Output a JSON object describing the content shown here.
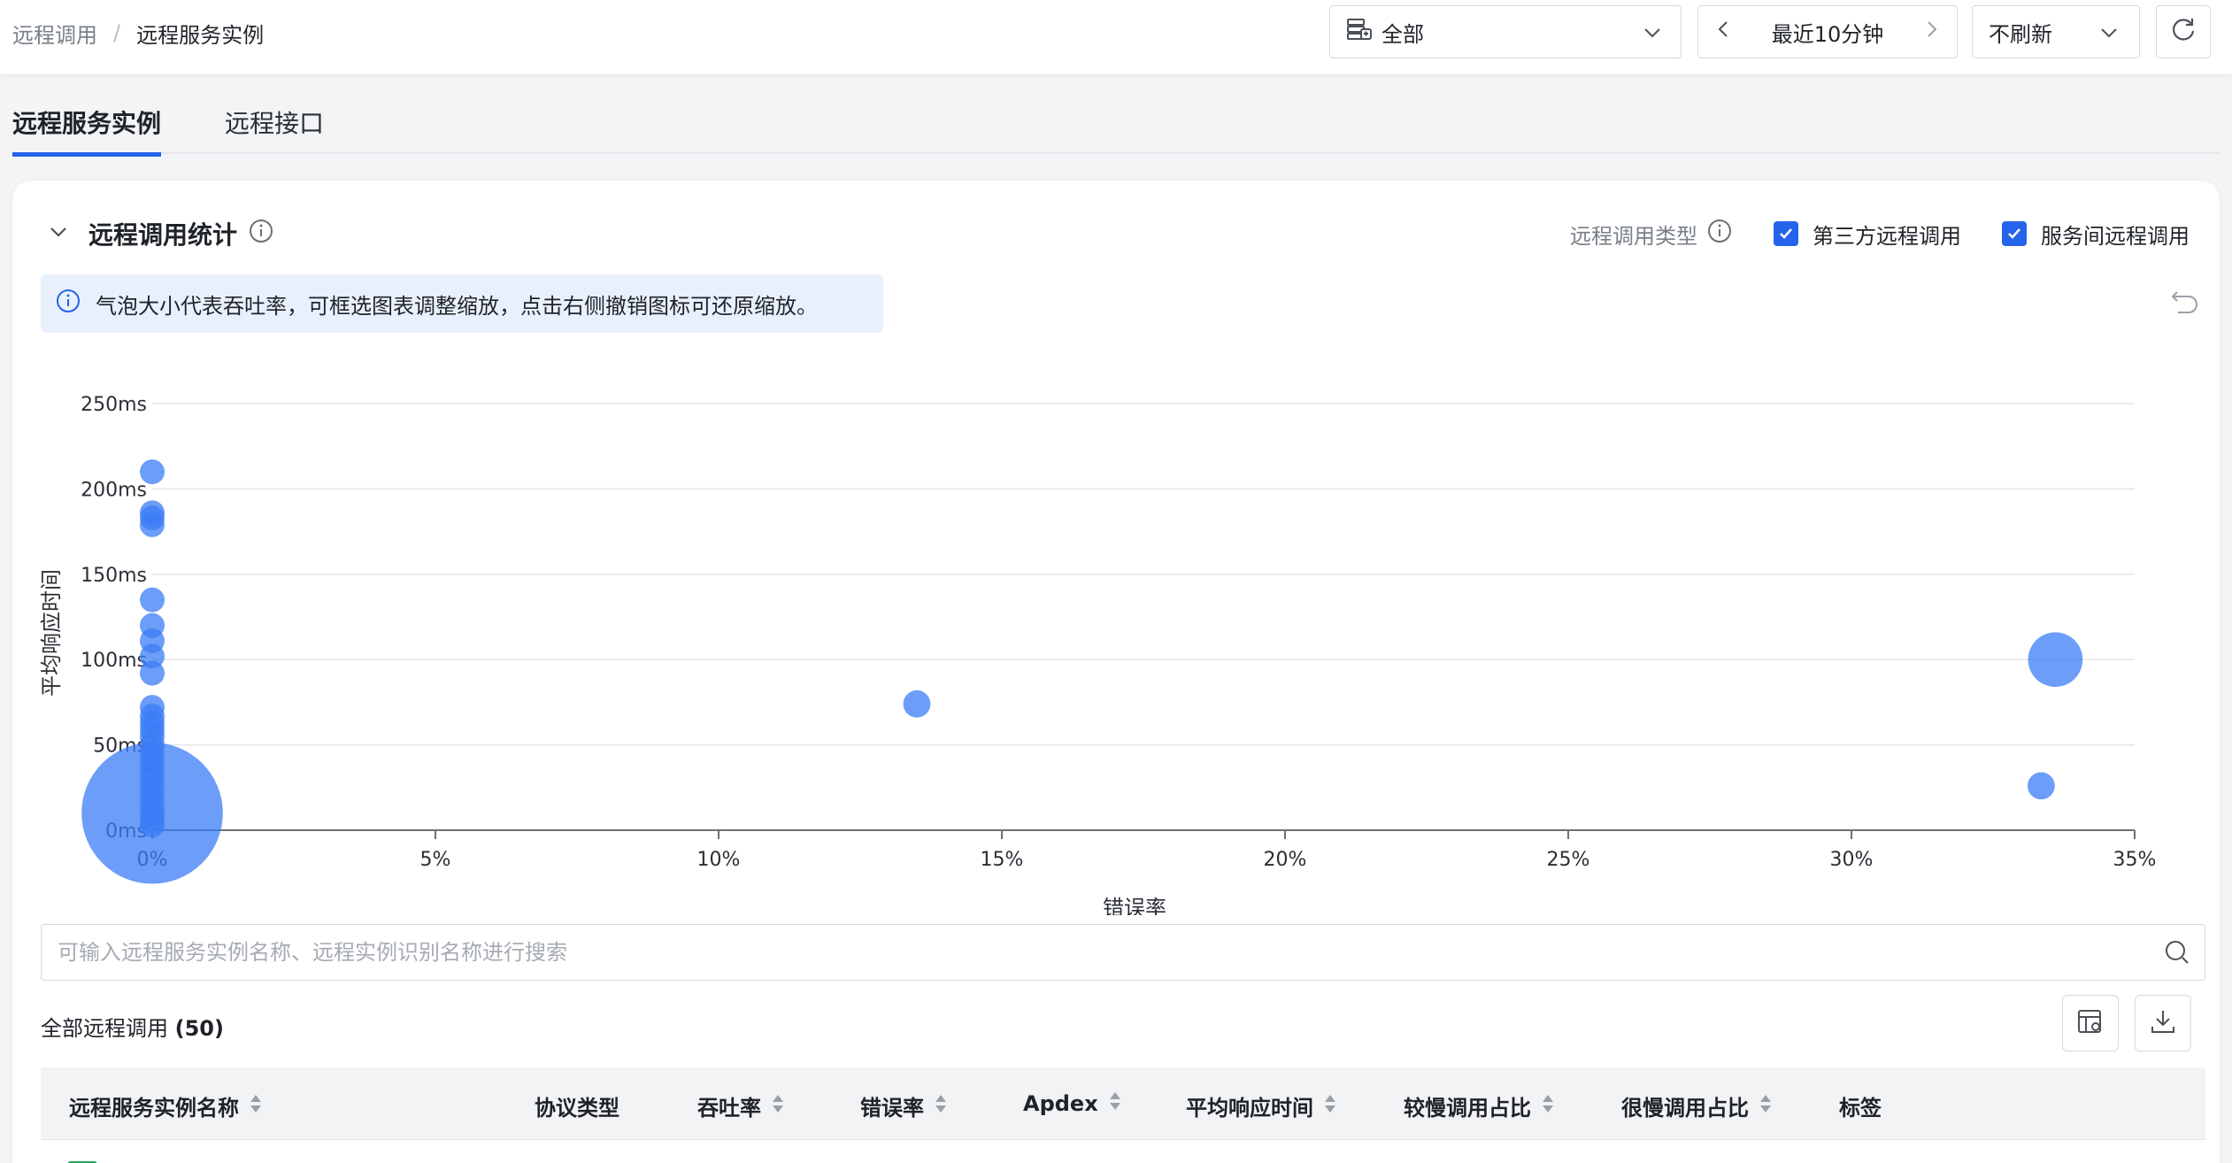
{
  "breadcrumb": {
    "parent": "远程调用",
    "separator": "/",
    "current": "远程服务实例"
  },
  "controls": {
    "scope_value": "全部",
    "time_range": "最近10分钟",
    "refresh": "不刷新"
  },
  "tabs": [
    {
      "label": "远程服务实例",
      "active": true
    },
    {
      "label": "远程接口",
      "active": false
    }
  ],
  "section": {
    "title": "远程调用统计",
    "filter_label": "远程调用类型",
    "checkboxes": [
      {
        "label": "第三方远程调用",
        "checked": true
      },
      {
        "label": "服务间远程调用",
        "checked": true
      }
    ],
    "tip": "气泡大小代表吞吐率，可框选图表调整缩放，点击右侧撤销图标可还原缩放。"
  },
  "colors": {
    "accent": "#2563eb",
    "bubble": "#3b7cf5",
    "tip_bg": "#e9f0fd"
  },
  "chart_data": {
    "type": "scatter",
    "xlabel": "错误率",
    "ylabel": "平均响应时间",
    "x_ticks": [
      "0%",
      "5%",
      "10%",
      "15%",
      "20%",
      "25%",
      "30%",
      "35%"
    ],
    "y_ticks": [
      "0ms",
      "50ms",
      "100ms",
      "150ms",
      "200ms",
      "250ms"
    ],
    "xlim": [
      0,
      35
    ],
    "ylim": [
      0,
      250
    ],
    "grid": true,
    "size_meaning": "吞吐率",
    "points": [
      {
        "x": 0,
        "y": 210,
        "size": 1
      },
      {
        "x": 0,
        "y": 186,
        "size": 1
      },
      {
        "x": 0,
        "y": 183,
        "size": 1
      },
      {
        "x": 0,
        "y": 179,
        "size": 1
      },
      {
        "x": 0,
        "y": 135,
        "size": 1
      },
      {
        "x": 0,
        "y": 120,
        "size": 1
      },
      {
        "x": 0,
        "y": 111,
        "size": 1
      },
      {
        "x": 0,
        "y": 102,
        "size": 1
      },
      {
        "x": 0,
        "y": 92,
        "size": 1
      },
      {
        "x": 0,
        "y": 72,
        "size": 1
      },
      {
        "x": 0,
        "y": 67,
        "size": 1
      },
      {
        "x": 0,
        "y": 63,
        "size": 1
      },
      {
        "x": 0,
        "y": 59,
        "size": 1
      },
      {
        "x": 0,
        "y": 55,
        "size": 1
      },
      {
        "x": 0,
        "y": 50,
        "size": 1
      },
      {
        "x": 0,
        "y": 45,
        "size": 1
      },
      {
        "x": 0,
        "y": 40,
        "size": 1
      },
      {
        "x": 0,
        "y": 35,
        "size": 1
      },
      {
        "x": 0,
        "y": 30,
        "size": 1
      },
      {
        "x": 0,
        "y": 25,
        "size": 1
      },
      {
        "x": 0,
        "y": 20,
        "size": 1
      },
      {
        "x": 0,
        "y": 15,
        "size": 1
      },
      {
        "x": 0,
        "y": 10,
        "size": 1
      },
      {
        "x": 0,
        "y": 6,
        "size": 1
      },
      {
        "x": 0,
        "y": 3,
        "size": 1
      },
      {
        "x": 0,
        "y": 10,
        "size": 5.7
      },
      {
        "x": 13.5,
        "y": 74,
        "size": 1.1
      },
      {
        "x": 33.6,
        "y": 100,
        "size": 2.2
      },
      {
        "x": 33.35,
        "y": 26,
        "size": 1.1
      }
    ]
  },
  "search": {
    "placeholder": "可输入远程服务实例名称、远程实例识别名称进行搜索"
  },
  "list": {
    "title": "全部远程调用",
    "count": "(50)"
  },
  "table": {
    "columns": [
      {
        "label": "远程服务实例名称",
        "sortable": true
      },
      {
        "label": "协议类型",
        "sortable": false
      },
      {
        "label": "吞吐率",
        "sortable": true
      },
      {
        "label": "错误率",
        "sortable": true
      },
      {
        "label": "Apdex",
        "sortable": true
      },
      {
        "label": "平均响应时间",
        "sortable": true
      },
      {
        "label": "较慢调用占比",
        "sortable": true
      },
      {
        "label": "很慢调用占比",
        "sortable": true
      },
      {
        "label": "标签",
        "sortable": false
      }
    ]
  }
}
